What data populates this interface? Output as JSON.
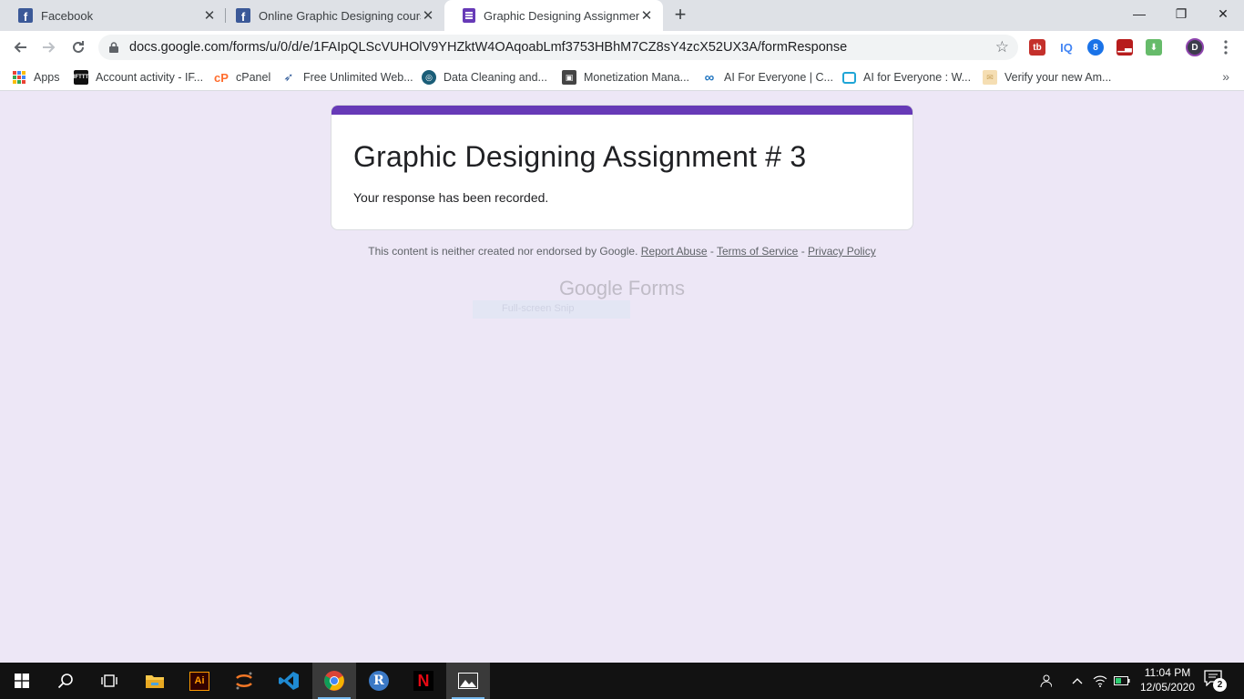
{
  "browser": {
    "tabs": [
      {
        "title": "Facebook",
        "icon": "facebook-icon",
        "active": false
      },
      {
        "title": "Online Graphic Designing course",
        "icon": "facebook-icon",
        "active": false
      },
      {
        "title": "Graphic Designing Assignment #",
        "icon": "google-forms-icon",
        "active": true
      }
    ],
    "window_controls": {
      "minimize": "—",
      "maximize": "❐",
      "close": "✕"
    },
    "url": "docs.google.com/forms/u/0/d/e/1FAIpQLScVUHOlV9YHZktW4OAqoabLmf3753HBhM7CZ8sY4zcX52UX3A/formResponse",
    "extensions": [
      "tubebuddy-icon",
      "iq-icon",
      "extension-icon",
      "chart-icon",
      "inbox-icon",
      "profile-icon"
    ]
  },
  "bookmarks": [
    {
      "label": "Apps",
      "icon": "apps-grid-icon"
    },
    {
      "label": "Account activity - IF...",
      "icon": "bookmark-icon"
    },
    {
      "label": "cPanel",
      "icon": "cpanel-icon"
    },
    {
      "label": "Free Unlimited Web...",
      "icon": "bird-icon"
    },
    {
      "label": "Data Cleaning and...",
      "icon": "globe-icon"
    },
    {
      "label": "Monetization Mana...",
      "icon": "page-icon"
    },
    {
      "label": "AI For Everyone | C...",
      "icon": "infinity-icon"
    },
    {
      "label": "AI for Everyone : W...",
      "icon": "tv-icon"
    },
    {
      "label": "Verify your new Am...",
      "icon": "mail-icon"
    }
  ],
  "form": {
    "title": "Graphic Designing Assignment # 3",
    "confirmation": "Your response has been recorded.",
    "accent_color": "#673ab7"
  },
  "footer": {
    "disclaimer": "This content is neither created nor endorsed by Google.",
    "report_abuse": "Report Abuse",
    "sep": "-",
    "terms": "Terms of Service",
    "privacy": "Privacy Policy",
    "logo_google": "Google",
    "logo_forms": "Forms",
    "snip_text": "Full-screen Snip"
  },
  "taskbar": {
    "apps": [
      "windows-start-icon",
      "search-icon",
      "task-view-icon",
      "file-explorer-icon",
      "illustrator-icon",
      "jupyter-icon",
      "vscode-icon",
      "chrome-icon",
      "r-icon",
      "netflix-icon",
      "photos-icon"
    ],
    "time": "11:04 PM",
    "date": "12/05/2020",
    "notification_count": "2"
  }
}
